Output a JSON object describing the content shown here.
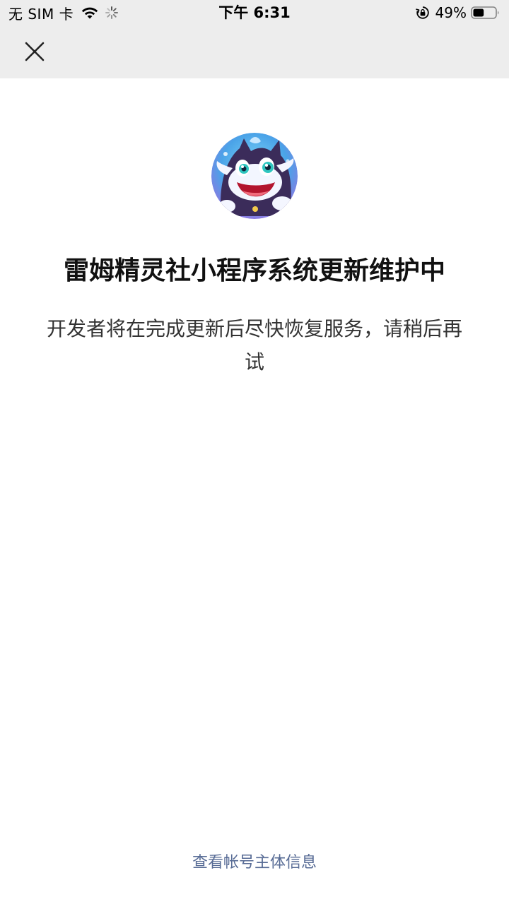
{
  "status_bar": {
    "carrier": "无 SIM 卡",
    "time": "下午 6:31",
    "battery_percent": "49%",
    "battery_level": 0.49,
    "icons": [
      "wifi-icon",
      "loading-icon",
      "lock-rotation-icon",
      "battery-icon"
    ]
  },
  "nav": {
    "close_icon": "close-icon"
  },
  "app": {
    "avatar_icon": "app-avatar-creature",
    "title": "雷姆精灵社小程序系统更新维护中",
    "description": "开发者将在完成更新后尽快恢复服务，请稍后再试"
  },
  "footer": {
    "link_label": "查看帐号主体信息",
    "link_color": "#576b95"
  },
  "colors": {
    "top_bar_bg": "#ededed",
    "page_bg": "#ffffff",
    "title_text": "#111111",
    "body_text": "#333333"
  }
}
